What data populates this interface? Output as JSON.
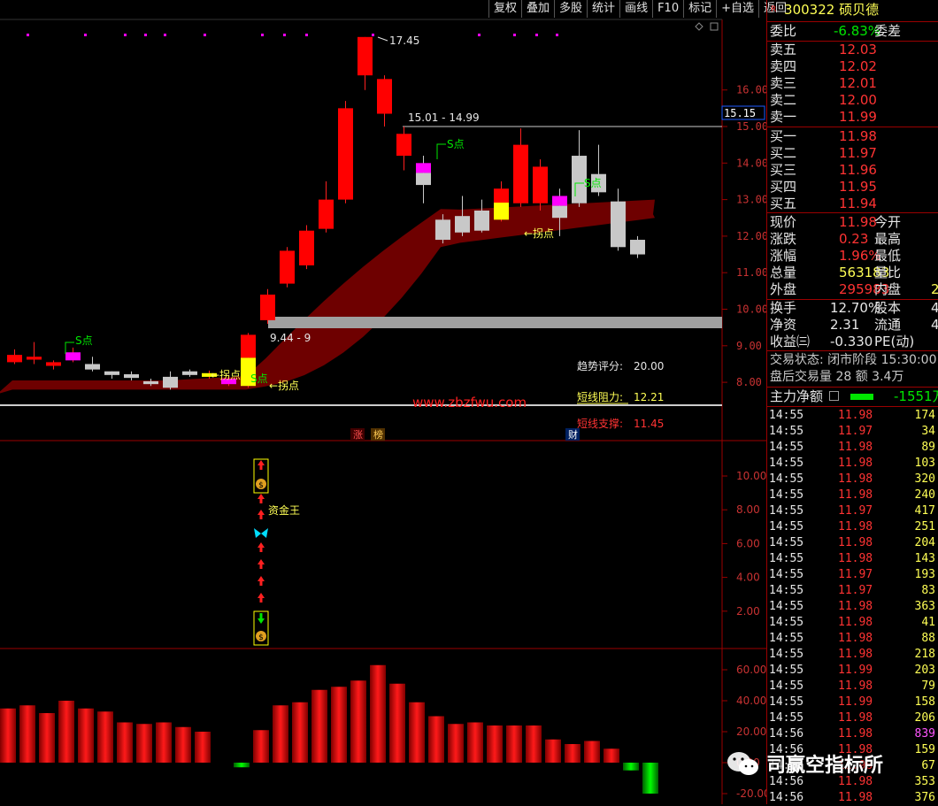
{
  "toolbar": [
    "复权",
    "叠加",
    "多股",
    "统计",
    "画线",
    "F10",
    "标记",
    "+自选",
    "返回"
  ],
  "stock": {
    "code": "300322",
    "name": "硕贝德",
    "flag": "R"
  },
  "quote": {
    "wb_label": "委比",
    "wb_value": "-6.83%",
    "wc_label": "委差",
    "asks": [
      {
        "l": "卖五",
        "p": "12.03"
      },
      {
        "l": "卖四",
        "p": "12.02"
      },
      {
        "l": "卖三",
        "p": "12.01"
      },
      {
        "l": "卖二",
        "p": "12.00"
      },
      {
        "l": "卖一",
        "p": "11.99"
      }
    ],
    "bids": [
      {
        "l": "买一",
        "p": "11.98"
      },
      {
        "l": "买二",
        "p": "11.97"
      },
      {
        "l": "买三",
        "p": "11.96"
      },
      {
        "l": "买四",
        "p": "11.95"
      },
      {
        "l": "买五",
        "p": "11.94"
      }
    ],
    "stats": [
      {
        "a": "现价",
        "v": "11.98",
        "b": "今开",
        "c": "red"
      },
      {
        "a": "涨跌",
        "v": "0.23",
        "b": "最高",
        "c": "red"
      },
      {
        "a": "涨幅",
        "v": "1.96%",
        "b": "最低",
        "c": "red"
      },
      {
        "a": "总量",
        "v": "563183",
        "b": "量比",
        "c": "yellow"
      },
      {
        "a": "外盘",
        "v": "295983",
        "b": "内盘",
        "c": "red",
        "extra": "2"
      }
    ],
    "stats2": [
      {
        "a": "换手",
        "v": "12.70%",
        "b": "股本",
        "extra": "4"
      },
      {
        "a": "净资",
        "v": "2.31",
        "b": "流通",
        "extra": "4"
      },
      {
        "a": "收益㈢",
        "v": "-0.330",
        "b": "PE(动)"
      }
    ],
    "trade_status": "交易状态: 闭市阶段 15:30:00",
    "after_hours": "盘后交易量 28 额 3.4万",
    "main_net_label": "主力净额",
    "main_net_value": "-1551万"
  },
  "ticks": [
    {
      "t": "14:55",
      "p": "11.98",
      "v": "174",
      "c": "red"
    },
    {
      "t": "14:55",
      "p": "11.97",
      "v": "34",
      "c": "red"
    },
    {
      "t": "14:55",
      "p": "11.98",
      "v": "89",
      "c": "red"
    },
    {
      "t": "14:55",
      "p": "11.98",
      "v": "103",
      "c": "red"
    },
    {
      "t": "14:55",
      "p": "11.98",
      "v": "320",
      "c": "red"
    },
    {
      "t": "14:55",
      "p": "11.98",
      "v": "240",
      "c": "red"
    },
    {
      "t": "14:55",
      "p": "11.97",
      "v": "417",
      "c": "red"
    },
    {
      "t": "14:55",
      "p": "11.98",
      "v": "251",
      "c": "red"
    },
    {
      "t": "14:55",
      "p": "11.98",
      "v": "204",
      "c": "red"
    },
    {
      "t": "14:55",
      "p": "11.98",
      "v": "143",
      "c": "red"
    },
    {
      "t": "14:55",
      "p": "11.97",
      "v": "193",
      "c": "red"
    },
    {
      "t": "14:55",
      "p": "11.97",
      "v": "83",
      "c": "red"
    },
    {
      "t": "14:55",
      "p": "11.98",
      "v": "363",
      "c": "red"
    },
    {
      "t": "14:55",
      "p": "11.98",
      "v": "41",
      "c": "red"
    },
    {
      "t": "14:55",
      "p": "11.98",
      "v": "88",
      "c": "red"
    },
    {
      "t": "14:55",
      "p": "11.98",
      "v": "218",
      "c": "red"
    },
    {
      "t": "14:55",
      "p": "11.99",
      "v": "203",
      "c": "red"
    },
    {
      "t": "14:55",
      "p": "11.98",
      "v": "79",
      "c": "red"
    },
    {
      "t": "14:55",
      "p": "11.99",
      "v": "158",
      "c": "red"
    },
    {
      "t": "14:55",
      "p": "11.98",
      "v": "206",
      "c": "red"
    },
    {
      "t": "14:56",
      "p": "11.98",
      "v": "839",
      "c": "mag"
    },
    {
      "t": "14:56",
      "p": "11.98",
      "v": "159",
      "c": "red"
    },
    {
      "t": "14:56",
      "p": "11.98",
      "v": "67",
      "c": "red"
    },
    {
      "t": "14:56",
      "p": "11.98",
      "v": "353",
      "c": "red"
    },
    {
      "t": "14:56",
      "p": "11.98",
      "v": "376",
      "c": "red"
    }
  ],
  "chart_data": {
    "type": "candlestick",
    "price_axis": [
      "16.00",
      "15.00",
      "14.00",
      "13.00",
      "12.00",
      "11.00",
      "10.00",
      "9.00",
      "8.00"
    ],
    "current_price_tag": "15.15",
    "candles": [
      {
        "o": 8.75,
        "c": 8.55,
        "h": 8.9,
        "l": 8.5,
        "color": "red"
      },
      {
        "o": 8.7,
        "c": 8.62,
        "h": 9.1,
        "l": 8.5,
        "color": "red"
      },
      {
        "o": 8.55,
        "c": 8.45,
        "h": 8.6,
        "l": 8.35,
        "color": "red"
      },
      {
        "o": 8.6,
        "c": 8.82,
        "h": 8.95,
        "l": 8.55,
        "color": "mag"
      },
      {
        "o": 8.35,
        "c": 8.5,
        "h": 8.7,
        "l": 8.3,
        "color": "gray"
      },
      {
        "o": 8.2,
        "c": 8.3,
        "h": 8.3,
        "l": 8.1,
        "color": "gray"
      },
      {
        "o": 8.12,
        "c": 8.22,
        "h": 8.3,
        "l": 8.05,
        "color": "gray"
      },
      {
        "o": 7.95,
        "c": 8.03,
        "h": 8.1,
        "l": 7.9,
        "color": "gray"
      },
      {
        "o": 7.85,
        "c": 8.15,
        "h": 8.3,
        "l": 7.8,
        "color": "gray"
      },
      {
        "o": 8.2,
        "c": 8.3,
        "h": 8.35,
        "l": 8.15,
        "color": "gray"
      },
      {
        "o": 8.15,
        "c": 8.25,
        "h": 8.32,
        "l": 8.1,
        "color": "yellow"
      },
      {
        "o": 7.95,
        "c": 8.1,
        "h": 8.2,
        "l": 7.9,
        "color": "mag"
      },
      {
        "o": 7.9,
        "c": 9.3,
        "h": 9.35,
        "l": 7.85,
        "color": "red_yellow"
      },
      {
        "o": 9.7,
        "c": 10.4,
        "h": 10.55,
        "l": 9.6,
        "color": "red"
      },
      {
        "o": 10.7,
        "c": 11.6,
        "h": 11.7,
        "l": 10.6,
        "color": "red"
      },
      {
        "o": 11.2,
        "c": 12.15,
        "h": 12.3,
        "l": 11.1,
        "color": "red"
      },
      {
        "o": 12.2,
        "c": 13.0,
        "h": 13.5,
        "l": 12.1,
        "color": "red"
      },
      {
        "o": 13.0,
        "c": 15.5,
        "h": 15.7,
        "l": 12.9,
        "color": "red"
      },
      {
        "o": 16.4,
        "c": 17.45,
        "h": 17.45,
        "l": 16.0,
        "color": "red"
      },
      {
        "o": 15.35,
        "c": 16.3,
        "h": 16.4,
        "l": 15.0,
        "color": "red"
      },
      {
        "o": 14.2,
        "c": 14.8,
        "h": 15.0,
        "l": 13.8,
        "color": "red"
      },
      {
        "o": 13.4,
        "c": 14.0,
        "h": 14.2,
        "l": 12.9,
        "color": "mag_gray"
      },
      {
        "o": 11.9,
        "c": 12.45,
        "h": 12.6,
        "l": 11.8,
        "color": "gray"
      },
      {
        "o": 12.1,
        "c": 12.55,
        "h": 13.1,
        "l": 12.0,
        "color": "gray"
      },
      {
        "o": 12.15,
        "c": 12.7,
        "h": 13.0,
        "l": 12.1,
        "color": "gray"
      },
      {
        "o": 12.45,
        "c": 13.3,
        "h": 13.5,
        "l": 12.4,
        "color": "red_yellow"
      },
      {
        "o": 12.9,
        "c": 14.5,
        "h": 14.95,
        "l": 12.8,
        "color": "red"
      },
      {
        "o": 12.9,
        "c": 13.9,
        "h": 14.1,
        "l": 12.7,
        "color": "red"
      },
      {
        "o": 12.5,
        "c": 13.1,
        "h": 13.3,
        "l": 12.0,
        "color": "mag_gray"
      },
      {
        "o": 12.9,
        "c": 14.2,
        "h": 14.9,
        "l": 12.8,
        "color": "gray"
      },
      {
        "o": 13.2,
        "c": 13.7,
        "h": 14.5,
        "l": 13.1,
        "color": "gray"
      },
      {
        "o": 11.7,
        "c": 12.95,
        "h": 13.3,
        "l": 11.6,
        "color": "gray"
      },
      {
        "o": 11.5,
        "c": 11.9,
        "h": 12.0,
        "l": 11.4,
        "color": "gray"
      }
    ],
    "labels": {
      "high_label": "17.45",
      "resist_label": "15.01 - 14.99",
      "support_label": "9.44 - 9",
      "s_point": "S点",
      "turn_point": "拐点",
      "trend_label": "趋势评分:",
      "trend_value": "20.00",
      "resist2_label": "短线阻力:",
      "resist2_value": "12.21",
      "support2_label": "短线支撑:",
      "support2_value": "11.45",
      "watermark": "www.zbzfwu.com",
      "zhang": "涨",
      "bang": "榜",
      "cai": "财"
    },
    "mid_axis": [
      "10.00",
      "8.00",
      "6.00",
      "4.00",
      "2.00"
    ],
    "mid_label": "资金王",
    "bottom_axis": [
      "60.00",
      "40.00",
      "20.00",
      "0.00",
      "-20.00"
    ],
    "bars": [
      35,
      37,
      32,
      40,
      35,
      33,
      26,
      25,
      26,
      23,
      20,
      0,
      -3,
      21,
      37,
      39,
      47,
      49,
      53,
      63,
      51,
      39,
      30,
      25,
      26,
      24,
      24,
      24,
      15,
      12,
      14,
      9,
      -5,
      -20
    ]
  },
  "wechat": {
    "name": "司赢空指标所"
  }
}
